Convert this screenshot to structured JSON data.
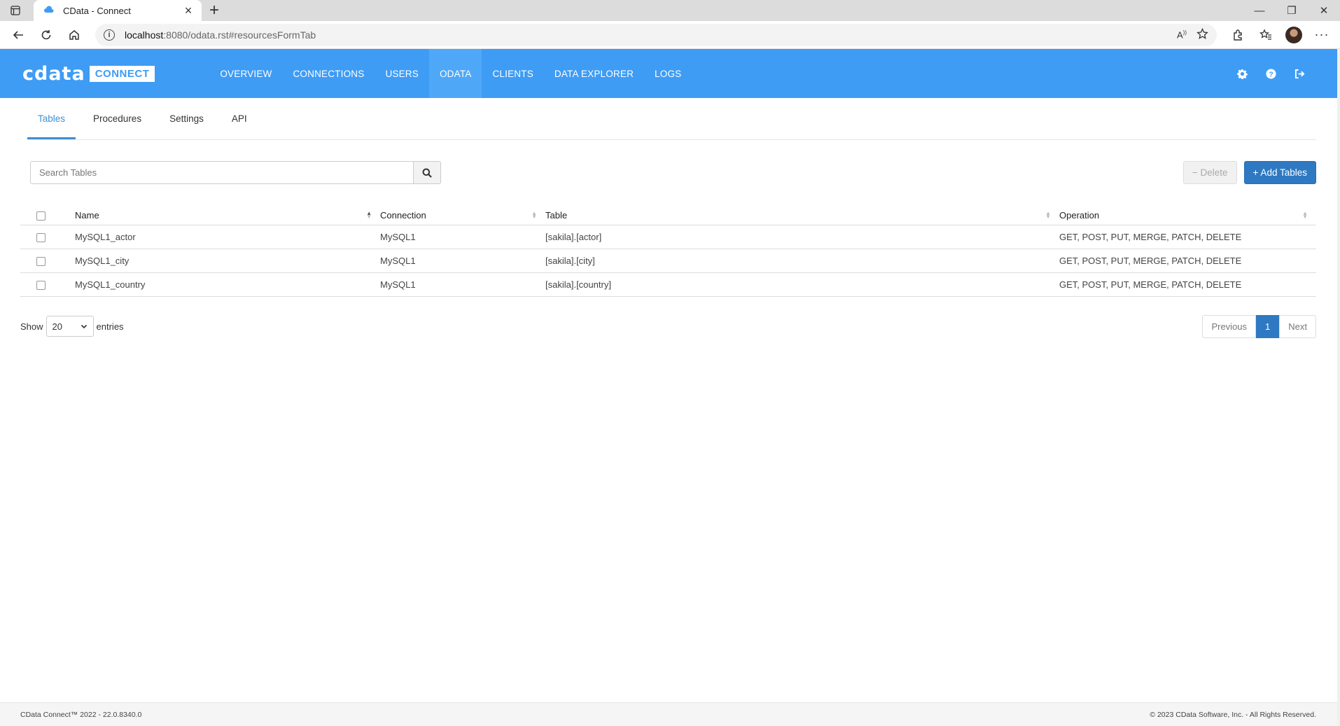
{
  "browser": {
    "tab_title": "CData - Connect",
    "url_host": "localhost",
    "url_rest": ":8080/odata.rst#resourcesFormTab"
  },
  "app": {
    "logo_text": "cdata",
    "logo_badge": "CONNECT",
    "nav": [
      "OVERVIEW",
      "CONNECTIONS",
      "USERS",
      "ODATA",
      "CLIENTS",
      "DATA EXPLORER",
      "LOGS"
    ],
    "active_nav": "ODATA",
    "accent": "#3e9cf5"
  },
  "subtabs": [
    "Tables",
    "Procedures",
    "Settings",
    "API"
  ],
  "search": {
    "placeholder": "Search Tables"
  },
  "buttons": {
    "delete": "− Delete",
    "add": "+ Add Tables"
  },
  "table": {
    "headers": [
      "Name",
      "Connection",
      "Table",
      "Operation"
    ],
    "rows": [
      [
        "MySQL1_actor",
        "MySQL1",
        "[sakila].[actor]",
        "GET, POST, PUT, MERGE, PATCH, DELETE"
      ],
      [
        "MySQL1_city",
        "MySQL1",
        "[sakila].[city]",
        "GET, POST, PUT, MERGE, PATCH, DELETE"
      ],
      [
        "MySQL1_country",
        "MySQL1",
        "[sakila].[country]",
        "GET, POST, PUT, MERGE, PATCH, DELETE"
      ]
    ]
  },
  "pager": {
    "show_label": "Show",
    "page_size": "20",
    "entries_label": "entries",
    "previous": "Previous",
    "current": "1",
    "next": "Next"
  },
  "footer": {
    "left": "CData Connect™ 2022 - 22.0.8340.0",
    "right": "© 2023 CData Software, Inc. - All Rights Reserved."
  }
}
